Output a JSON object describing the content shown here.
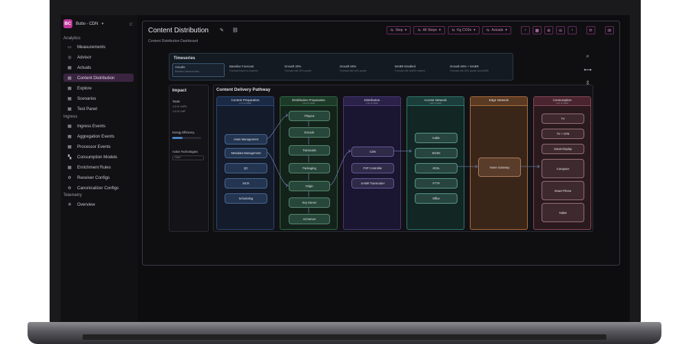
{
  "brand": {
    "logo": "BC",
    "name": "Bubo - CDN",
    "caret_icon": "chevron-down-icon",
    "collapse_icon": "sidebar-collapse-icon"
  },
  "sidebar": {
    "sections": [
      "Analytics",
      "Ingress",
      "Telemetry"
    ],
    "analytics": [
      {
        "label": "Measurements",
        "icon": "ruler-icon"
      },
      {
        "label": "Advisor",
        "icon": "advisor-icon"
      },
      {
        "label": "Actuals",
        "icon": "grid-icon"
      },
      {
        "label": "Content Distribution",
        "icon": "grid-icon",
        "active": true
      },
      {
        "label": "Explore",
        "icon": "grid-icon"
      },
      {
        "label": "Scenarios",
        "icon": "grid-icon"
      },
      {
        "label": "Test Panel",
        "icon": "grid-icon"
      }
    ],
    "ingress": [
      {
        "label": "Ingress Events",
        "icon": "grid-icon"
      },
      {
        "label": "Aggregation Events",
        "icon": "grid-icon"
      },
      {
        "label": "Processor Events",
        "icon": "grid-icon"
      },
      {
        "label": "Consumption Models",
        "icon": "model-icon"
      },
      {
        "label": "Enrichment Rules",
        "icon": "grid-icon"
      },
      {
        "label": "Receiver Configs",
        "icon": "config-icon"
      },
      {
        "label": "Canonicalizer Configs",
        "icon": "config-icon"
      }
    ],
    "telemetry": [
      {
        "label": "Overview",
        "icon": "gear-icon"
      }
    ]
  },
  "header": {
    "title": "Content Distribution",
    "subtitle": "Content Distribution Dashboard",
    "edit_icon": "pencil-icon",
    "link_icon": "link-icon"
  },
  "toolbar": {
    "dropdowns": [
      "Step",
      "All Steps",
      "Kg CO2e",
      "Actuals"
    ],
    "buttons": [
      "chevron-left-icon",
      "calendar-icon",
      "zoom-in-icon",
      "zoom-out-icon",
      "chevron-right-icon"
    ],
    "refresh_icon": "refresh-icon",
    "add_icon": "add-icon"
  },
  "timeseries": {
    "title": "Timeseries",
    "cards": [
      {
        "label": "Actuals",
        "desc": "Baseline historical data",
        "active": true
      },
      {
        "label": "Baseline Forecast",
        "desc": "Forecast based on baseline",
        "active": false
      },
      {
        "label": "Growth 30%",
        "desc": "Forecast with 30% growth",
        "active": false
      },
      {
        "label": "Growth 60%",
        "desc": "Forecast with 60% growth",
        "active": false
      },
      {
        "label": "MABR Enabled",
        "desc": "Forecast with MABR enabled",
        "active": false
      },
      {
        "label": "Growth 60% + MABR",
        "desc": "Forecast with 60% growth and MABR",
        "active": false
      }
    ]
  },
  "side_tools": [
    "search-icon",
    "fit-width-icon",
    "fit-height-icon"
  ],
  "impact": {
    "title": "Impact",
    "totals_label": "Totals",
    "totals": [
      "1,3,01 CdPh",
      "1,3,01 CdP"
    ],
    "energy_label": "Energy Efficiency",
    "energy_level": 0.35,
    "tech_label": "Active Technologies",
    "tech_value": "CMAF"
  },
  "pathway": {
    "title": "Content Delivery Pathway",
    "columns": [
      {
        "name": "Content Preparation",
        "sub": "1.71 of TkWh",
        "nodes": [
          "Asset Management",
          "Metadata Management",
          "QC",
          "MCR",
          "Scheduling"
        ]
      },
      {
        "name": "Distribution Preparation",
        "sub": "2.91 of TkWh",
        "nodes": [
          "Playout",
          "Encode",
          "Transcode",
          "Packaging",
          "Origin",
          "Key Server",
          "Ad Server"
        ]
      },
      {
        "name": "Distribution",
        "sub": "0.91 of TkWh",
        "nodes": [
          "CDN",
          "P2P Controller",
          "mABR Transcoder"
        ]
      },
      {
        "name": "Access Network",
        "sub": "1.85 of TkWh",
        "nodes": [
          "Cable",
          "4G/5G",
          "ADSL",
          "FTTP",
          "Office"
        ]
      },
      {
        "name": "Edge Network",
        "sub": "",
        "nodes": [
          "Home Gateway"
        ]
      },
      {
        "name": "Consumption",
        "sub": "2.87 of TkWh",
        "nodes": [
          "TV",
          "TV + STB",
          "Smart Display",
          "Computer",
          "Smart Phone",
          "Tablet"
        ]
      }
    ]
  },
  "colors": {
    "accent": "#c0349a",
    "col_content": "#2b4a78",
    "col_distprep": "#2f6a46",
    "col_distribution": "#4a3a7a",
    "col_access": "#2f7a6e",
    "col_edge": "#b07040",
    "col_consumption": "#8a4a58"
  }
}
